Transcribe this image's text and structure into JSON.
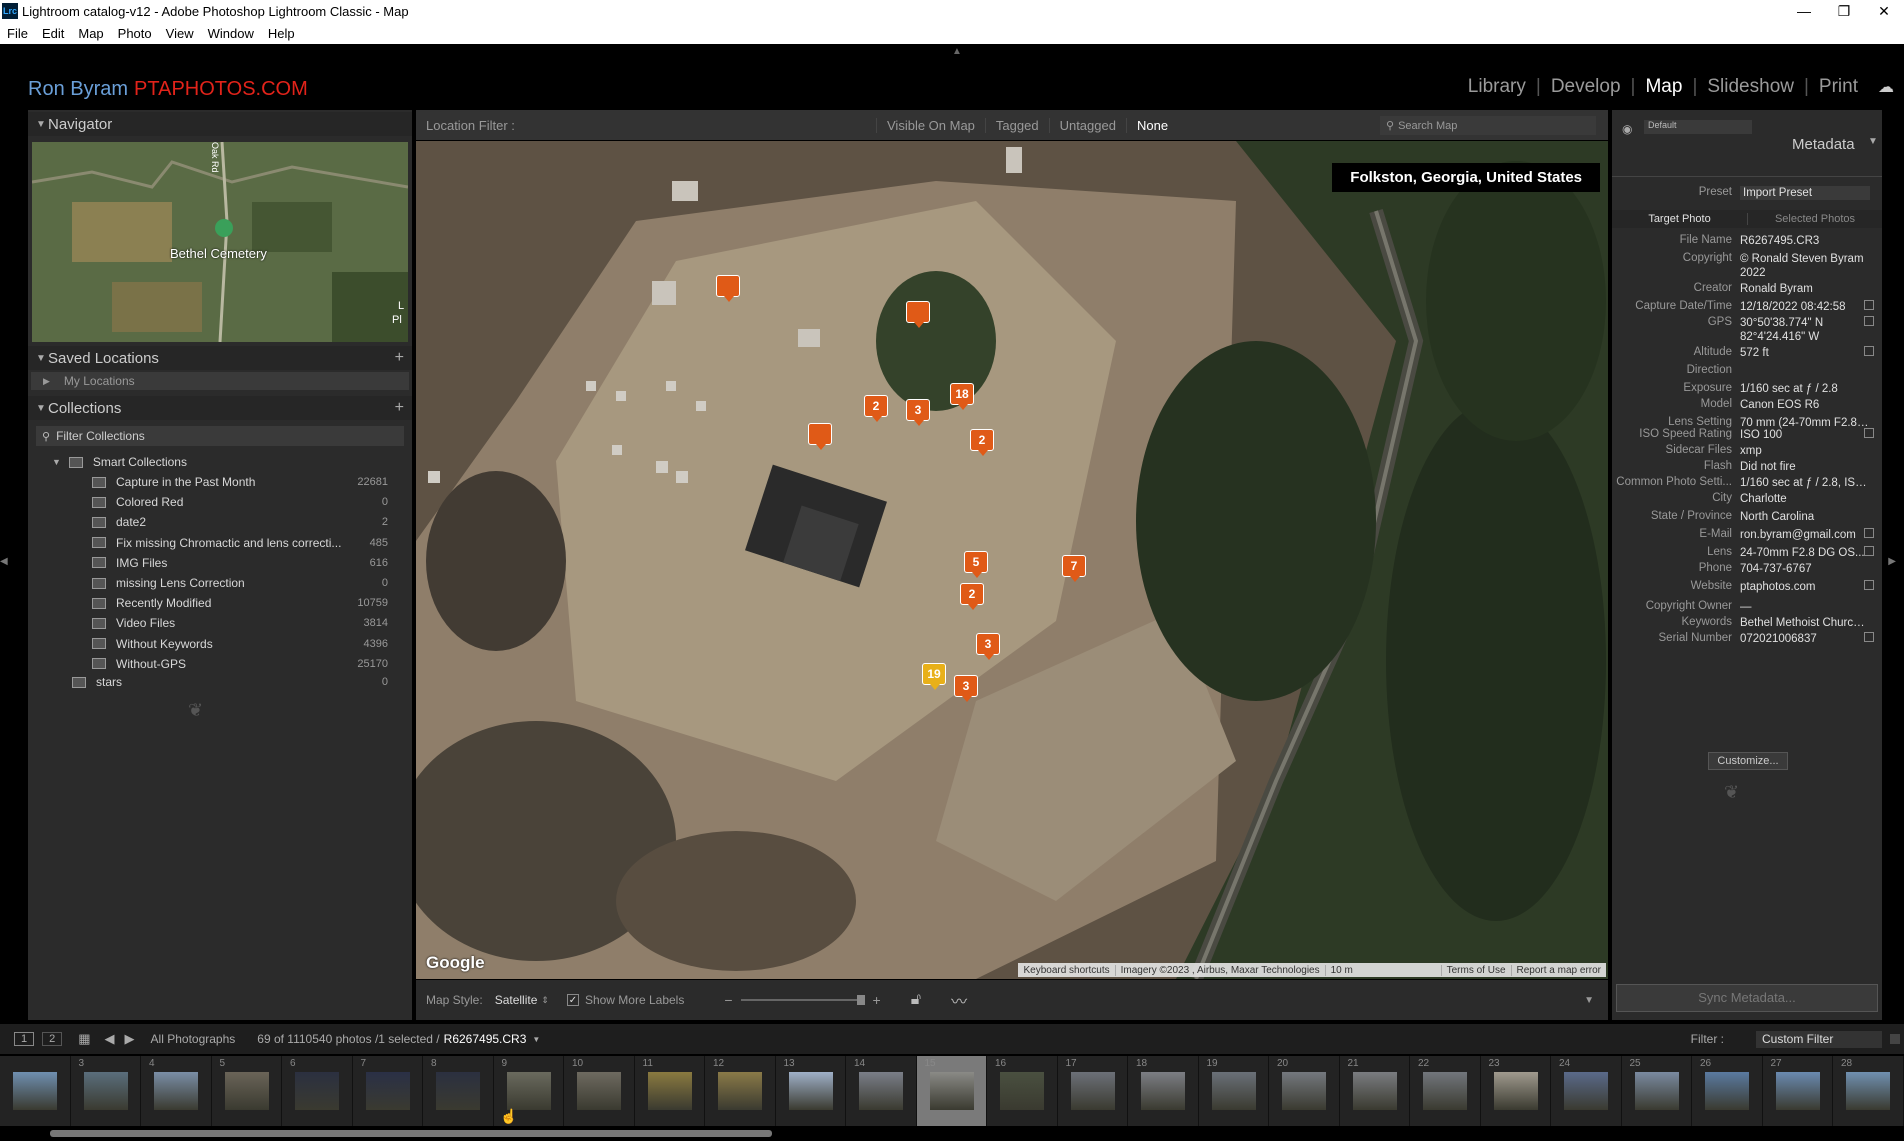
{
  "window": {
    "title": "Lightroom catalog-v12 - Adobe Photoshop Lightroom Classic - Map",
    "app_icon": "Lrc"
  },
  "menu": [
    "File",
    "Edit",
    "Map",
    "Photo",
    "View",
    "Window",
    "Help"
  ],
  "identity": {
    "name": "Ron Byram",
    "brand": "PTAPHOTOS.COM"
  },
  "modules": [
    {
      "label": "Library",
      "active": false
    },
    {
      "label": "Develop",
      "active": false
    },
    {
      "label": "Map",
      "active": true
    },
    {
      "label": "Slideshow",
      "active": false
    },
    {
      "label": "Print",
      "active": false
    }
  ],
  "left": {
    "navigator": {
      "title": "Navigator",
      "map_label": "Bethel Cemetery",
      "road_label": "Oak Rd",
      "edge_label_1": "L",
      "edge_label_2": "Pl"
    },
    "saved_locations": {
      "title": "Saved Locations",
      "folder": "My Locations"
    },
    "collections": {
      "title": "Collections",
      "filter_placeholder": "Filter Collections",
      "smart_set": "Smart Collections",
      "items": [
        {
          "name": "Capture in the Past Month",
          "count": "22681"
        },
        {
          "name": "Colored Red",
          "count": "0"
        },
        {
          "name": "date2",
          "count": "2"
        },
        {
          "name": "Fix missing Chromactic and lens correcti...",
          "count": "485"
        },
        {
          "name": "IMG Files",
          "count": "616"
        },
        {
          "name": "missing Lens Correction",
          "count": "0"
        },
        {
          "name": "Recently Modified",
          "count": "10759"
        },
        {
          "name": "Video Files",
          "count": "3814"
        },
        {
          "name": "Without Keywords",
          "count": "4396"
        },
        {
          "name": "Without-GPS",
          "count": "25170"
        }
      ],
      "stars": {
        "name": "stars",
        "count": "0"
      }
    }
  },
  "map": {
    "filter_label": "Location Filter :",
    "filters": [
      "Visible On Map",
      "Tagged",
      "Untagged",
      "None"
    ],
    "active_filter": "None",
    "search_placeholder": "Search Map",
    "location": "Folkston, Georgia, United States",
    "google": "Google",
    "attribution": [
      "Keyboard shortcuts",
      "Imagery ©2023 , Airbus, Maxar Technologies",
      "10 m",
      "Terms of Use",
      "Report a map error"
    ],
    "pins": [
      "",
      "",
      "2",
      "3",
      "18",
      "",
      "2",
      "5",
      "7",
      "2",
      "3",
      "19",
      "3"
    ],
    "selected_pin": "19",
    "style_label": "Map Style:",
    "style_value": "Satellite",
    "more_labels": "Show More Labels",
    "more_labels_checked": true
  },
  "right": {
    "preset_top": "Default",
    "title": "Metadata",
    "preset_label": "Preset",
    "preset_value": "Import Preset",
    "tabs": [
      "Target Photo",
      "Selected Photos"
    ],
    "fields": [
      {
        "label": "File Name",
        "value": "R6267495.CR3"
      },
      {
        "label": "Copyright",
        "value": "© Ronald Steven Byram",
        "value2": "2022"
      },
      {
        "label": "Creator",
        "value": "Ronald Byram"
      },
      {
        "label": "Capture Date/Time",
        "value": "12/18/2022 08:42:58"
      },
      {
        "label": "GPS",
        "value": "30°50'38.774\" N",
        "value2": "82°4'24.416\" W"
      },
      {
        "label": "Altitude",
        "value": "572 ft"
      },
      {
        "label": "Direction",
        "value": ""
      },
      {
        "label": "Exposure",
        "value": "1/160 sec at ƒ / 2.8"
      },
      {
        "label": "Model",
        "value": "Canon EOS R6"
      },
      {
        "label": "Lens Setting",
        "value": "70 mm (24-70mm F2.8 DG..."
      },
      {
        "label": "ISO Speed Rating",
        "value": "ISO 100"
      },
      {
        "label": "Sidecar Files",
        "value": "xmp"
      },
      {
        "label": "Flash",
        "value": "Did not fire"
      },
      {
        "label": "Common Photo Setti...",
        "value": "1/160 sec at ƒ / 2.8, ISO 100, 7"
      },
      {
        "label": "City",
        "value": "Charlotte"
      },
      {
        "label": "State / Province",
        "value": "North Carolina"
      },
      {
        "label": "E-Mail",
        "value": "ron.byram@gmail.com"
      },
      {
        "label": "Lens",
        "value": "24-70mm F2.8 DG OS..."
      },
      {
        "label": "Phone",
        "value": "704-737-6767"
      },
      {
        "label": "Website",
        "value": "ptaphotos.com"
      },
      {
        "label": "Copyright Owner",
        "value": "—"
      },
      {
        "label": "Keywords",
        "value": "Bethel Methoist Church, F..."
      },
      {
        "label": "Serial Number",
        "value": "072021006837"
      }
    ],
    "customize": "Customize...",
    "sync": "Sync Metadata..."
  },
  "filmbar": {
    "page1": "1",
    "page2": "2",
    "source": "All Photographs",
    "count": "69 of 1110540 photos /1 selected /",
    "filename": "R6267495.CR3",
    "filter_label": "Filter :",
    "filter_value": "Custom Filter"
  },
  "filmstrip": [
    "",
    "3",
    "4",
    "5",
    "6",
    "7",
    "8",
    "9",
    "10",
    "11",
    "12",
    "13",
    "14",
    "15",
    "16",
    "17",
    "18",
    "19",
    "20",
    "21",
    "22",
    "23",
    "24",
    "25",
    "26",
    "27",
    "28"
  ],
  "selected_frame": "15"
}
